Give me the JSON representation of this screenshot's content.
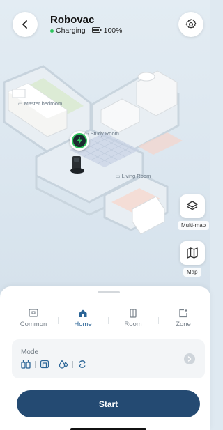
{
  "header": {
    "title": "Robovac",
    "status": "Charging",
    "battery": "100%"
  },
  "map": {
    "rooms": {
      "master_bedroom": "Master bedroom",
      "study_room": "Study Room",
      "living_room": "Living Room"
    }
  },
  "side_buttons": {
    "multi_map": "Multi-map",
    "map": "Map"
  },
  "tabs": [
    {
      "label": "Common",
      "active": false
    },
    {
      "label": "Home",
      "active": true
    },
    {
      "label": "Room",
      "active": false
    },
    {
      "label": "Zone",
      "active": false
    }
  ],
  "mode": {
    "title": "Mode",
    "icons": [
      "vacuum-mop-icon",
      "mop-icon",
      "water-level-icon",
      "cycle-icon"
    ]
  },
  "start_label": "Start",
  "colors": {
    "accent": "#2a6496",
    "start_button": "#244a72",
    "charging_dot": "#2ec45c",
    "charging_icon": "#1f7a3a"
  }
}
